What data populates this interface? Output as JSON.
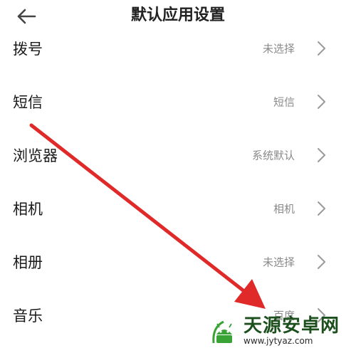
{
  "header": {
    "title": "默认应用设置",
    "back_icon": "arrow-left-icon"
  },
  "settings": [
    {
      "label": "拨号",
      "value": "未选择"
    },
    {
      "label": "短信",
      "value": "短信"
    },
    {
      "label": "浏览器",
      "value": "系统默认"
    },
    {
      "label": "相机",
      "value": "相机"
    },
    {
      "label": "相册",
      "value": "未选择"
    },
    {
      "label": "音乐",
      "value": "百度"
    }
  ],
  "annotation": {
    "arrow_color": "#e02a2a",
    "icon": "arrow-annotation"
  },
  "watermark": {
    "name": "天源安卓网",
    "url": "www.jytyaz.com",
    "brand_color": "#1b4f1b"
  }
}
